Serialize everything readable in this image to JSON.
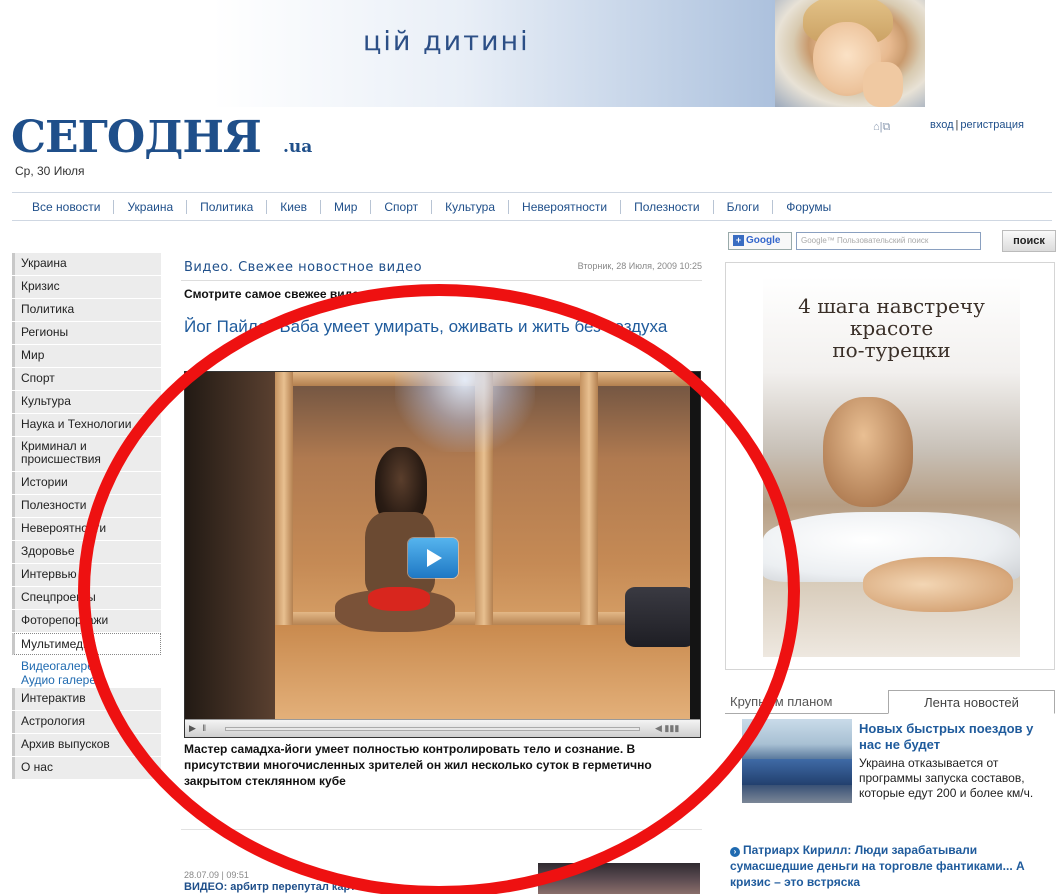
{
  "banner": {
    "text": "цій дитині"
  },
  "header": {
    "logo": "СЕГОДНЯ",
    "logo_suffix": ".ua",
    "date": "Ср, 30 Июля",
    "login": "вход",
    "register": "регистрация",
    "login_separator": "|"
  },
  "nav": [
    "Все новости",
    "Украина",
    "Политика",
    "Киев",
    "Мир",
    "Спорт",
    "Культура",
    "Невероятности",
    "Полезности",
    "Блоги",
    "Форумы"
  ],
  "sidebar": {
    "items": [
      "Украина",
      "Кризис",
      "Политика",
      "Регионы",
      "Мир",
      "Спорт",
      "Культура",
      "Наука и Технологии",
      "Криминал и происшествия",
      "Истории",
      "Полезности",
      "Невероятности",
      "Здоровье",
      "Интервью",
      "Спецпроекты",
      "Фоторепортажи",
      "Мультимедиа"
    ],
    "subitems": [
      "Видеогалереи",
      "Аудио галереи"
    ],
    "items_after": [
      "Интерактив",
      "Астрология",
      "Архив выпусков",
      "О нас"
    ]
  },
  "main": {
    "section_title": "Видео. Свежее новостное видео",
    "section_date": "Вторник, 28 Июля, 2009 10:25",
    "subtitle": "Смотрите самое свежее видео",
    "headline": "Йог Пайлот Баба умеет умирать, оживать и жить без воздуха",
    "lead": "Мастер самадха-йоги умеет полностью контролировать тело и сознание. В присутствии многочисленных зрителей он жил несколько суток в герметично закрытом стеклянном кубе",
    "next_date": "28.07.09 | 09:51",
    "next_title": "ВИДЕО: арбитр перепутал карточки"
  },
  "search": {
    "brand": "Google",
    "placeholder": "Google™ Пользовательский поиск",
    "button": "поиск"
  },
  "ad": {
    "title": "4 шага навстречу\nкрасоте\nпо-турецки"
  },
  "tabs": [
    "Крупным планом",
    "Лента новостей"
  ],
  "side_news": {
    "title": "Новых быстрых поездов у нас не будет",
    "text": "Украина отказывается от программы запуска составов, которые едут 200 и более км/ч.",
    "second": "Патриарх Кирилл: Люди зарабатывали сумасшедшие деньги на торговле фантиками... А кризис – это встряска"
  },
  "colors": {
    "brand": "#1f4f8a",
    "link": "#1f5b9c",
    "annotation_ring": "#ee1111"
  }
}
